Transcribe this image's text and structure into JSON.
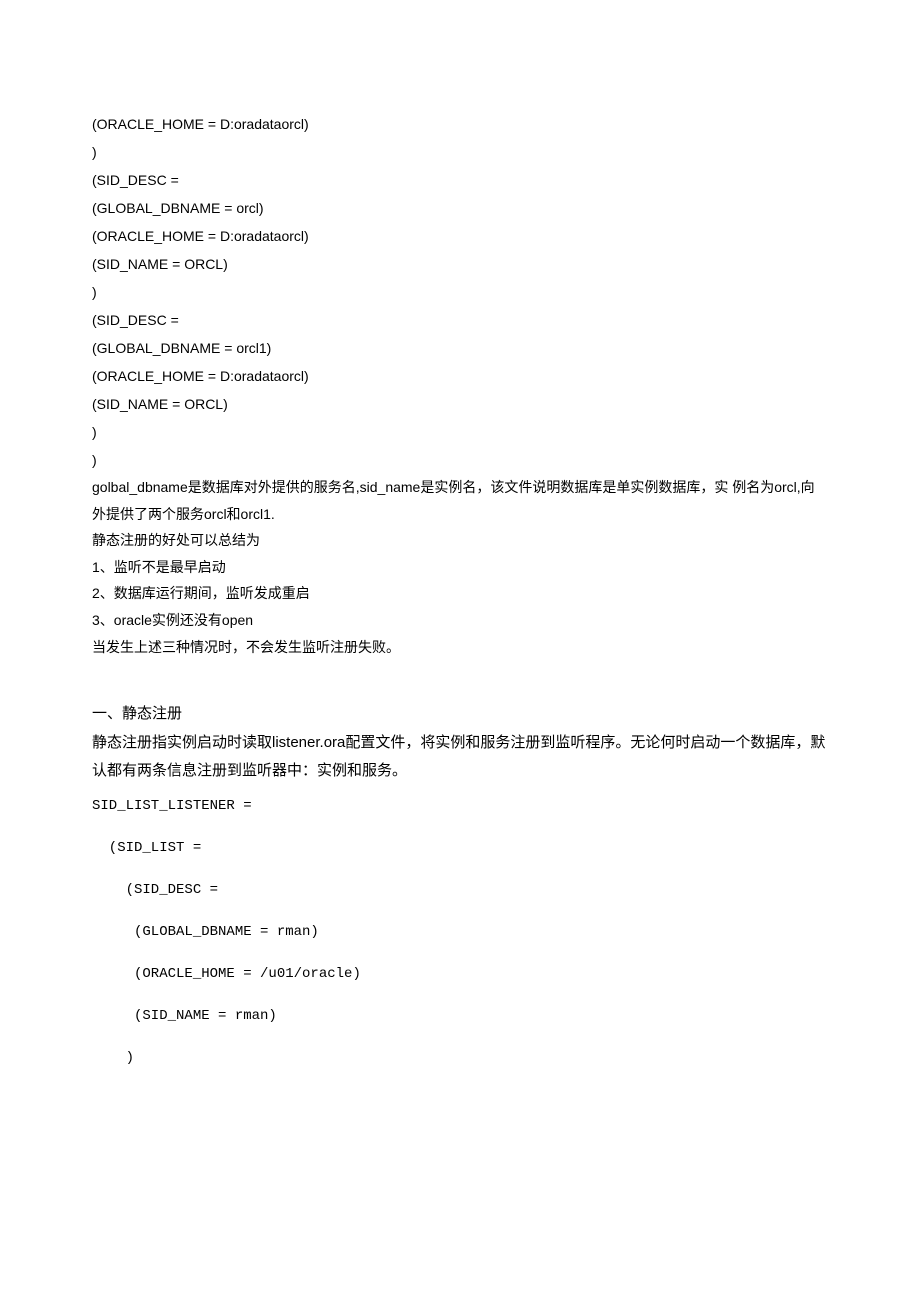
{
  "config_lines": [
    "(ORACLE_HOME = D:oradataorcl)",
    ")",
    "(SID_DESC =",
    "(GLOBAL_DBNAME = orcl)",
    "(ORACLE_HOME = D:oradataorcl)",
    "(SID_NAME = ORCL)",
    ")",
    "(SID_DESC =",
    "(GLOBAL_DBNAME = orcl1)",
    "(ORACLE_HOME = D:oradataorcl)",
    "(SID_NAME = ORCL)",
    ")",
    ")"
  ],
  "explain_1": "golbal_dbname是数据库对外提供的服务名,sid_name是实例名，该文件说明数据库是单实例数据库，实 例名为orcl,向外提供了两个服务orcl和orcl1.",
  "explain_2": "静态注册的好处可以总结为",
  "bullet_1": "1、监听不是最早启动",
  "bullet_2": "2、数据库运行期间，监听发成重启",
  "bullet_3": "3、oracle实例还没有open",
  "explain_3": "当发生上述三种情况时，不会发生监听注册失败。",
  "section_heading": "一、静态注册",
  "section_body": "静态注册指实例启动时读取listener.ora配置文件，将实例和服务注册到监听程序。无论何时启动一个数据库，默认都有两条信息注册到监听器中：实例和服务。",
  "code_block": "SID_LIST_LISTENER =\n\n  (SID_LIST =\n\n    (SID_DESC =\n\n     (GLOBAL_DBNAME = rman)\n\n     (ORACLE_HOME = /u01/oracle)\n\n     (SID_NAME = rman)\n\n    )"
}
